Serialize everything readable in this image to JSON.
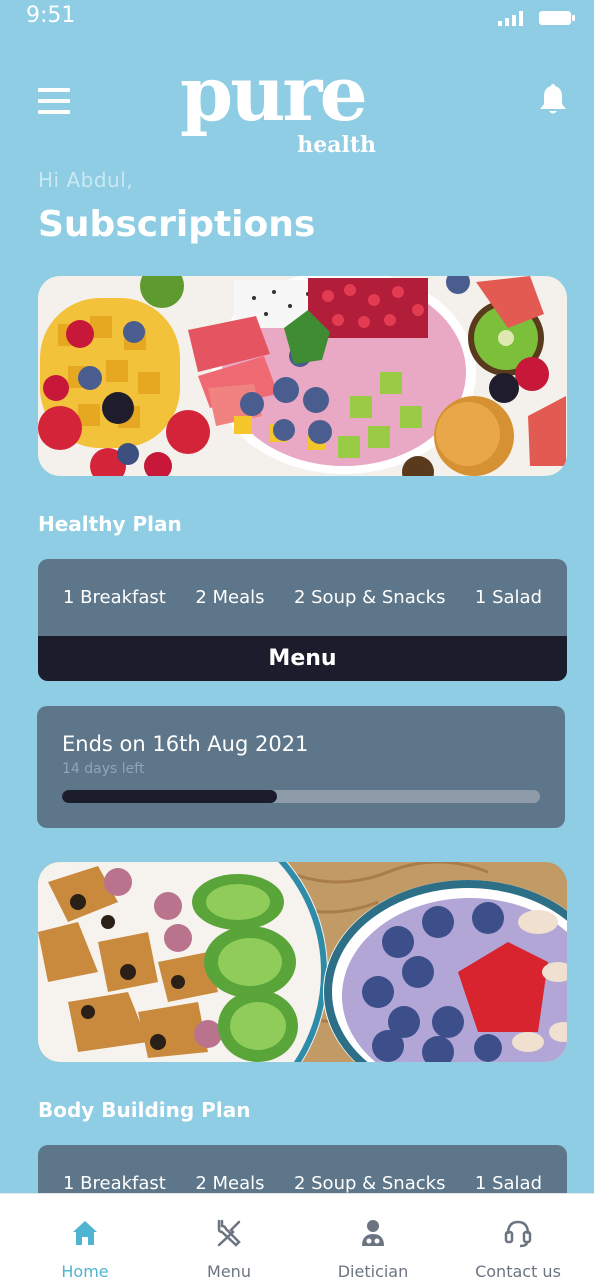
{
  "status": {
    "time": "9:51"
  },
  "header": {
    "logo_main": "pure",
    "logo_sub": "health"
  },
  "greeting": "Hi Abdul,",
  "page_title": "Subscriptions",
  "plans": [
    {
      "name": "Healthy Plan",
      "items": [
        "1 Breakfast",
        "2 Meals",
        "2 Soup & Snacks",
        "1 Salad"
      ],
      "menu_label": "Menu",
      "ends_text": "Ends on 16th Aug 2021",
      "days_left": "14 days left",
      "progress": 0.45
    },
    {
      "name": "Body Building Plan",
      "items": [
        "1 Breakfast",
        "2 Meals",
        "2 Soup & Snacks",
        "1 Salad"
      ]
    }
  ],
  "nav": [
    {
      "label": "Home",
      "icon": "home-icon",
      "active": true
    },
    {
      "label": "Menu",
      "icon": "fork-knife-icon",
      "active": false
    },
    {
      "label": "Dietician",
      "icon": "doctor-icon",
      "active": false
    },
    {
      "label": "Contact us",
      "icon": "headset-icon",
      "active": false
    }
  ],
  "colors": {
    "background": "#8ecde3",
    "card": "#5e7689",
    "dark": "#1c1d2c",
    "accent": "#4fb3d2"
  }
}
